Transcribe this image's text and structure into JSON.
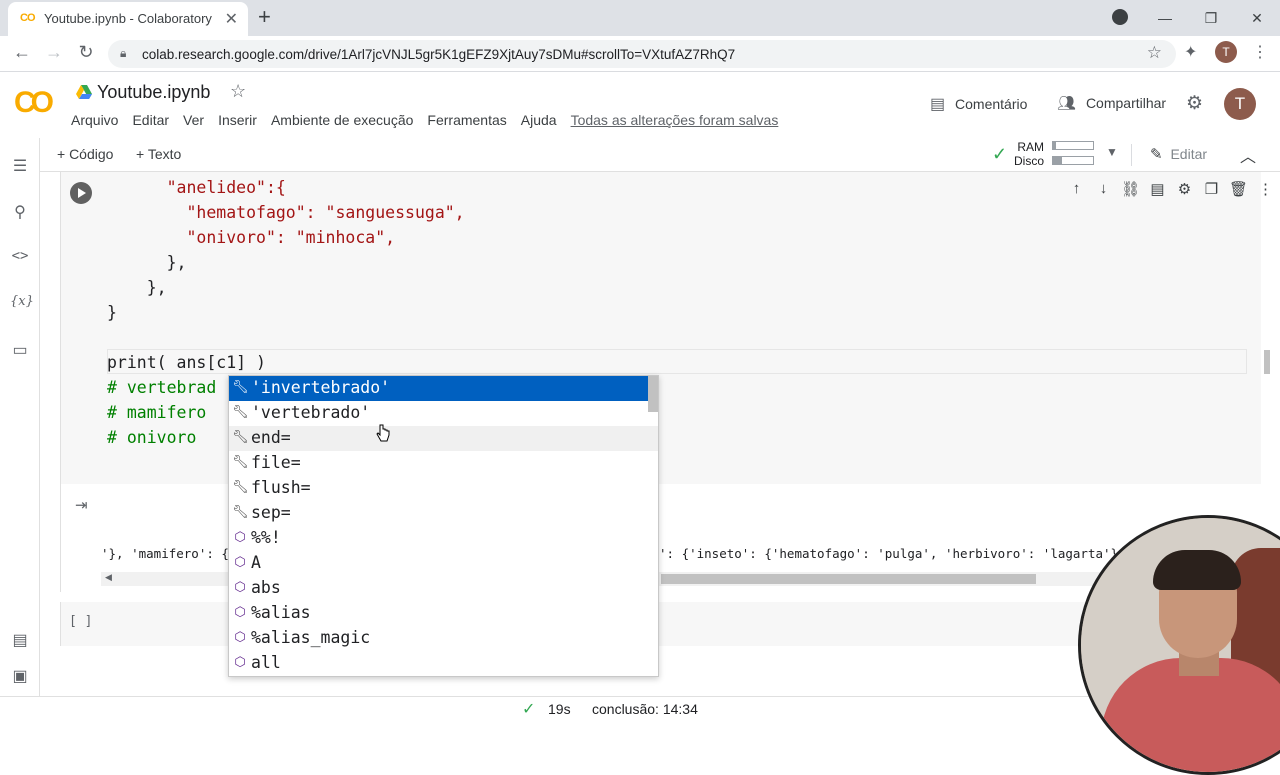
{
  "browser": {
    "tab_title": "Youtube.ipynb - Colaboratory",
    "tab_logo": "CO",
    "url": "colab.research.google.com/drive/1Arl7jcVNJL5gr5K1gEFZ9XjtAuy7sDMu#scrollTo=VXtufAZ7RhQ7",
    "profile_initial": "T"
  },
  "header": {
    "logo": "CO",
    "notebook_title": "Youtube.ipynb",
    "menu": [
      "Arquivo",
      "Editar",
      "Ver",
      "Inserir",
      "Ambiente de execução",
      "Ferramentas",
      "Ajuda"
    ],
    "saved_status": "Todas as alterações foram salvas",
    "comment_label": "Comentário",
    "share_label": "Compartilhar",
    "user_initial": "T"
  },
  "toolbar": {
    "add_code": "+ Código",
    "add_text": "+ Texto",
    "ram_label": "RAM",
    "disk_label": "Disco",
    "ram_usage": 0.08,
    "disk_usage": 0.22,
    "edit_label": "Editar"
  },
  "code": {
    "lines": [
      "      \"anelideo\":{",
      "        \"hematofago\": \"sanguessuga\",",
      "        \"onivoro\": \"minhoca\",",
      "      },",
      "    },",
      "}",
      "",
      "print( ans[c1] )",
      "# vertebrad",
      "# mamifero",
      "# onivoro"
    ]
  },
  "output": {
    "text_left": "'}, 'mamifero': {",
    "text_right": "': {'inseto': {'hematofago': 'pulga', 'herbivoro': 'lagarta'}, 'a"
  },
  "empty_cell": {
    "brackets": "[ ]"
  },
  "autocomplete": {
    "items": [
      {
        "label": "'invertebrado'",
        "icon": "wrench-icon"
      },
      {
        "label": "'vertebrado'",
        "icon": "wrench-icon"
      },
      {
        "label": "end=",
        "icon": "wrench-icon"
      },
      {
        "label": "file=",
        "icon": "wrench-icon"
      },
      {
        "label": "flush=",
        "icon": "wrench-icon"
      },
      {
        "label": "sep=",
        "icon": "wrench-icon"
      },
      {
        "label": "%%!",
        "icon": "cube-icon"
      },
      {
        "label": "A",
        "icon": "cube-icon"
      },
      {
        "label": "abs",
        "icon": "cube-icon"
      },
      {
        "label": "%alias",
        "icon": "cube-icon"
      },
      {
        "label": "%alias_magic",
        "icon": "cube-icon"
      },
      {
        "label": "all",
        "icon": "cube-icon"
      }
    ]
  },
  "status": {
    "elapsed": "19s",
    "completed": "conclusão: 14:34"
  }
}
